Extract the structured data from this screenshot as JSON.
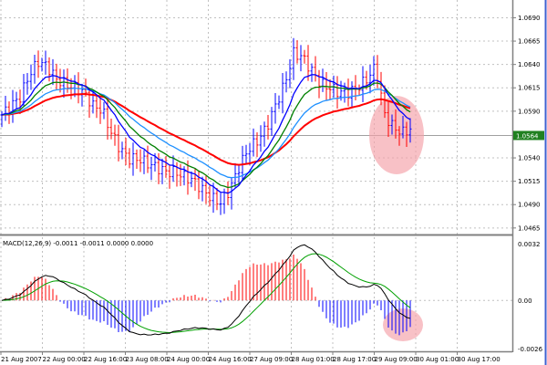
{
  "chart_data": [
    {
      "type": "line",
      "title": "EURUSD-like price chart (bars with moving averages)",
      "x_tick_labels": [
        "21 Aug 2007",
        "22 Aug 00:00",
        "22 Aug 16:00",
        "23 Aug 08:00",
        "24 Aug 00:00",
        "24 Aug 16:00",
        "27 Aug 09:00",
        "28 Aug 01:00",
        "28 Aug 17:00",
        "29 Aug 09:00",
        "30 Aug 01:00",
        "30 Aug 17:00"
      ],
      "y_tick_labels": [
        "1.0690",
        "1.0665",
        "1.0640",
        "1.0615",
        "1.0590",
        "1.0540",
        "1.0515",
        "1.0490",
        "1.0465"
      ],
      "ylim": [
        1.0458,
        1.0709
      ],
      "current_price_label": "1.0564",
      "closes": [
        1.0586,
        1.0596,
        1.0605,
        1.0629,
        1.0643,
        1.0638,
        1.0624,
        1.0619,
        1.0615,
        1.061,
        1.0596,
        1.0591,
        1.0567,
        1.0549,
        1.0539,
        1.0539,
        1.0534,
        1.053,
        1.0525,
        1.0525,
        1.052,
        1.0516,
        1.0506,
        1.0497,
        1.0492,
        1.0506,
        1.053,
        1.0549,
        1.0558,
        1.0572,
        1.0596,
        1.0619,
        1.0652,
        1.0648,
        1.0633,
        1.0619,
        1.0615,
        1.061,
        1.061,
        1.0615,
        1.0624,
        1.0638,
        1.0586,
        1.0572,
        1.0567,
        1.0572
      ],
      "moving_averages": [
        {
          "name": "fast",
          "period": 5,
          "color": "#0000ff"
        },
        {
          "name": "ma-green",
          "period": 8,
          "color": "#008000"
        },
        {
          "name": "ma-blue",
          "period": 13,
          "color": "#1e90ff"
        },
        {
          "name": "ma-red",
          "period": 21,
          "color": "#ff0000"
        }
      ],
      "bar_colors": {
        "up": "#0000ff",
        "down": "#ff0000"
      },
      "grid": true
    },
    {
      "type": "bar",
      "title": "MACD(12,26,9) -0.0011 -0.0011 0.0000 0.0000",
      "y_tick_labels": [
        "0.0032",
        "0.00",
        "-0.0026"
      ],
      "ylim": [
        -0.0026,
        0.0032
      ],
      "series": [
        {
          "name": "histogram",
          "colors": {
            "positive": "#ff0000",
            "negative": "#0000ff"
          }
        },
        {
          "name": "macd",
          "color": "#000000"
        },
        {
          "name": "signal",
          "color": "#00a000"
        }
      ]
    }
  ],
  "highlight_color": "#f4a0a8"
}
